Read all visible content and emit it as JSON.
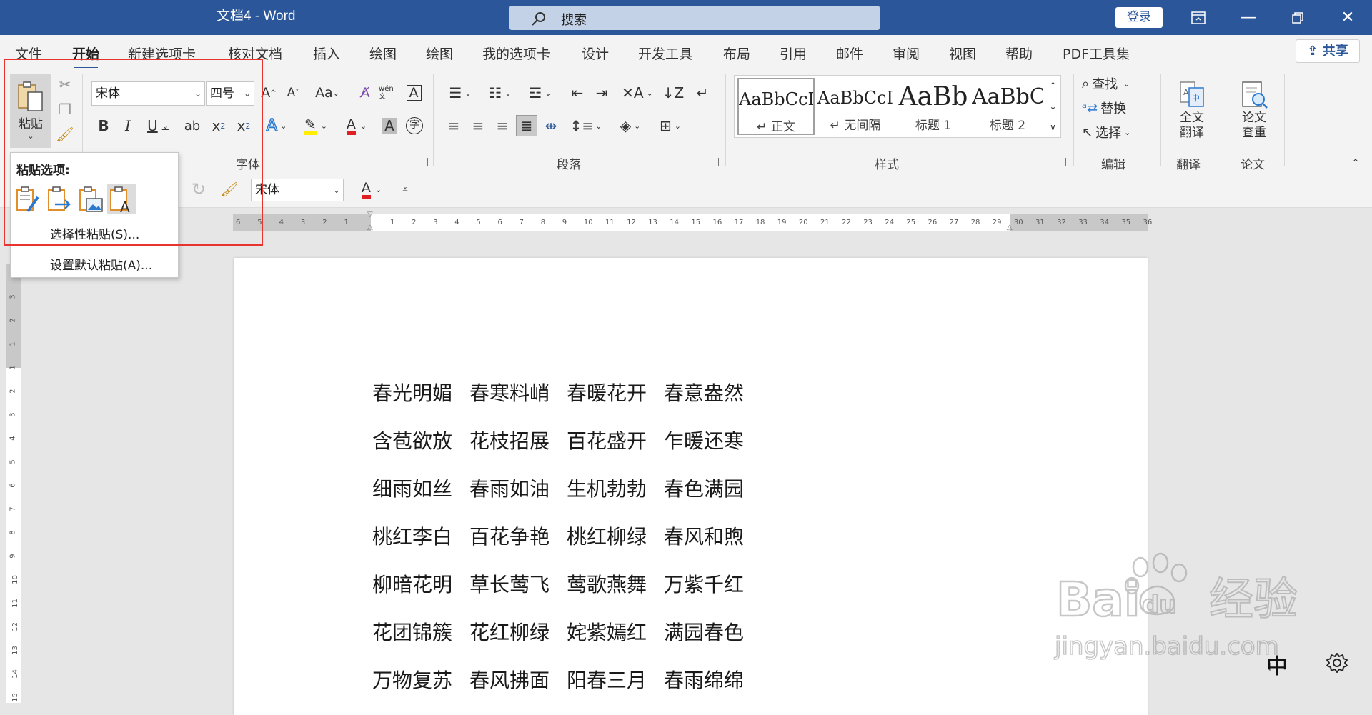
{
  "titlebar": {
    "doc_title": "文档4  -  Word",
    "search_placeholder": "搜索",
    "login": "登录"
  },
  "tabs": [
    "文件",
    "开始",
    "新建选项卡",
    "核对文档",
    "插入",
    "绘图",
    "绘图",
    "我的选项卡",
    "设计",
    "开发工具",
    "布局",
    "引用",
    "邮件",
    "审阅",
    "视图",
    "帮助",
    "PDF工具集"
  ],
  "active_tab": "开始",
  "share": "共享",
  "clipboard": {
    "paste_label": "粘贴"
  },
  "font": {
    "name": "宋体",
    "size": "四号",
    "group_label": "字体",
    "aa_label": "Aa",
    "wen_label": "wén 文"
  },
  "paragraph": {
    "group_label": "段落"
  },
  "styles": {
    "group_label": "样式",
    "items": [
      {
        "sample": "AaBbCcI",
        "name": "↵ 正文"
      },
      {
        "sample": "AaBbCcI",
        "name": "↵ 无间隔"
      },
      {
        "sample": "AaBb",
        "name": "标题 1"
      },
      {
        "sample": "AaBbC",
        "name": "标题 2"
      }
    ]
  },
  "editing": {
    "group_label": "编辑",
    "find": "查找",
    "replace": "替换",
    "select": "选择"
  },
  "translate": {
    "group_label": "翻译",
    "button": "全文\n翻译"
  },
  "paper": {
    "group_label": "论文",
    "button": "论文\n查重"
  },
  "qat": {
    "font_name": "宋体"
  },
  "paste_popup": {
    "title": "粘贴选项:",
    "special": "选择性粘贴(S)...",
    "default": "设置默认粘贴(A)..."
  },
  "ruler": {
    "left_ticks": [
      "6",
      "5",
      "4",
      "3",
      "2",
      "1"
    ],
    "ticks": [
      "1",
      "2",
      "3",
      "4",
      "5",
      "6",
      "7",
      "8",
      "9",
      "10",
      "11",
      "12",
      "13",
      "14",
      "15",
      "16",
      "17",
      "18",
      "19",
      "20",
      "21",
      "22",
      "23",
      "24",
      "25",
      "26",
      "27",
      "28",
      "29",
      "30",
      "31",
      "32",
      "33",
      "34",
      "35",
      "36"
    ],
    "v_ticks": [
      "3",
      "2",
      "1",
      "1",
      "2",
      "3",
      "4",
      "5",
      "6",
      "7",
      "8",
      "9",
      "10",
      "11",
      "12",
      "13",
      "14",
      "15"
    ]
  },
  "document": {
    "lines": [
      [
        "春光明媚",
        "春寒料峭",
        "春暖花开",
        "春意盎然"
      ],
      [
        "含苞欲放",
        "花枝招展",
        "百花盛开",
        "乍暖还寒"
      ],
      [
        "细雨如丝",
        "春雨如油",
        "生机勃勃",
        "春色满园"
      ],
      [
        "桃红李白",
        "百花争艳",
        "桃红柳绿",
        "春风和煦"
      ],
      [
        "柳暗花明",
        "草长莺飞",
        "莺歌燕舞",
        "万紫千红"
      ],
      [
        "花团锦簇",
        "花红柳绿",
        "姹紫嫣红",
        "满园春色"
      ],
      [
        "万物复苏",
        "春风拂面",
        "阳春三月",
        "春雨绵绵"
      ]
    ]
  },
  "watermark": {
    "brand": "Bai",
    "brand_du": "du",
    "jingyan": "经验",
    "url": "jingyan.baidu.com"
  },
  "ime": "中"
}
